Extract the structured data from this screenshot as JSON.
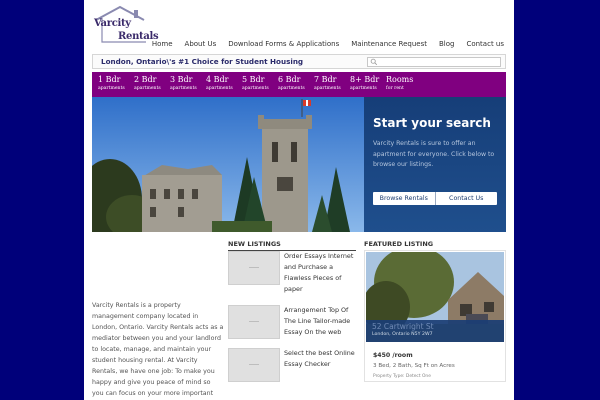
{
  "header": {
    "logo_word1": "Varcity",
    "logo_word2": "Rentals",
    "nav": [
      "Home",
      "About Us",
      "Download Forms & Applications",
      "Maintenance Request",
      "Blog",
      "Contact us"
    ]
  },
  "tagline": "London, Ontario\\'s #1 Choice for Student Housing",
  "search": {
    "placeholder": ""
  },
  "bed_nav": [
    {
      "big": "1 Bdr",
      "small": "apartments"
    },
    {
      "big": "2 Bdr",
      "small": "apartments"
    },
    {
      "big": "3 Bdr",
      "small": "apartments"
    },
    {
      "big": "4 Bdr",
      "small": "apartments"
    },
    {
      "big": "5 Bdr",
      "small": "apartments"
    },
    {
      "big": "6 Bdr",
      "small": "apartments"
    },
    {
      "big": "7 Bdr",
      "small": "apartments"
    },
    {
      "big": "8+ Bdr",
      "small": "apartments"
    },
    {
      "big": "Rooms",
      "small": "for rent"
    }
  ],
  "search_panel": {
    "title": "Start your search",
    "description": "Varcity Rentals is sure to offer an apartment for everyone. Click below to browse our listings.",
    "browse_label": "Browse Rentals",
    "contact_label": "Contact Us"
  },
  "about_text": "Varcity Rentals is a property management company located in London, Ontario. Varcity Rentals acts as a mediator between you and your landlord to locate, manage, and maintain your student housing rental. At Varcity Rentals, we have one job: To make you happy and give you peace of mind so you can focus on your more important student goals.",
  "new_listings": {
    "heading": "NEW LISTINGS",
    "items": [
      {
        "title": "Order Essays Internet and Purchase a Flawless Pieces of paper"
      },
      {
        "title": "Arrangement Top Of The Line Tailor-made Essay On the web"
      },
      {
        "title": "Select the best Online Essay Checker"
      }
    ]
  },
  "featured": {
    "heading": "FEATURED LISTING",
    "address": "52 Cartwright St",
    "city": "London, Ontario N5Y 2W7",
    "price": "$450 /room",
    "info": "3 Bed, 2 Bath, Sq Ft on Acres",
    "type": "Property Type: Detect One"
  },
  "colors": {
    "background": "#00007a",
    "nav_purple": "#800080",
    "search_panel": "#1a4580"
  }
}
